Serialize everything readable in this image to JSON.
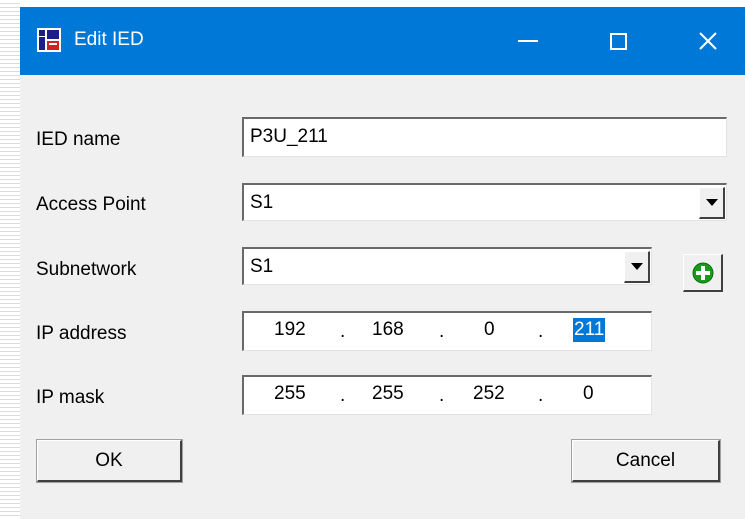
{
  "window": {
    "title": "Edit IED",
    "app_icon": "ied-app-icon",
    "controls": [
      "minimize-icon",
      "maximize-icon",
      "close-icon"
    ]
  },
  "form": {
    "ied_name": {
      "label": "IED name",
      "value": "P3U_211"
    },
    "access_point": {
      "label": "Access Point",
      "value": "S1"
    },
    "subnetwork": {
      "label": "Subnetwork",
      "value": "S1",
      "add_icon": "plus-circle-icon"
    },
    "ip_address": {
      "label": "IP address",
      "octets": [
        "192",
        "168",
        "0",
        "211"
      ],
      "separator": "."
    },
    "ip_mask": {
      "label": "IP mask",
      "octets": [
        "255",
        "255",
        "252",
        "0"
      ],
      "separator": "."
    }
  },
  "buttons": {
    "ok": "OK",
    "cancel": "Cancel"
  },
  "colors": {
    "titlebar": "#0078d7",
    "dialog_bg": "#f0f0f0",
    "selection": "#0078d7",
    "add_icon": "#1a9a1a"
  }
}
